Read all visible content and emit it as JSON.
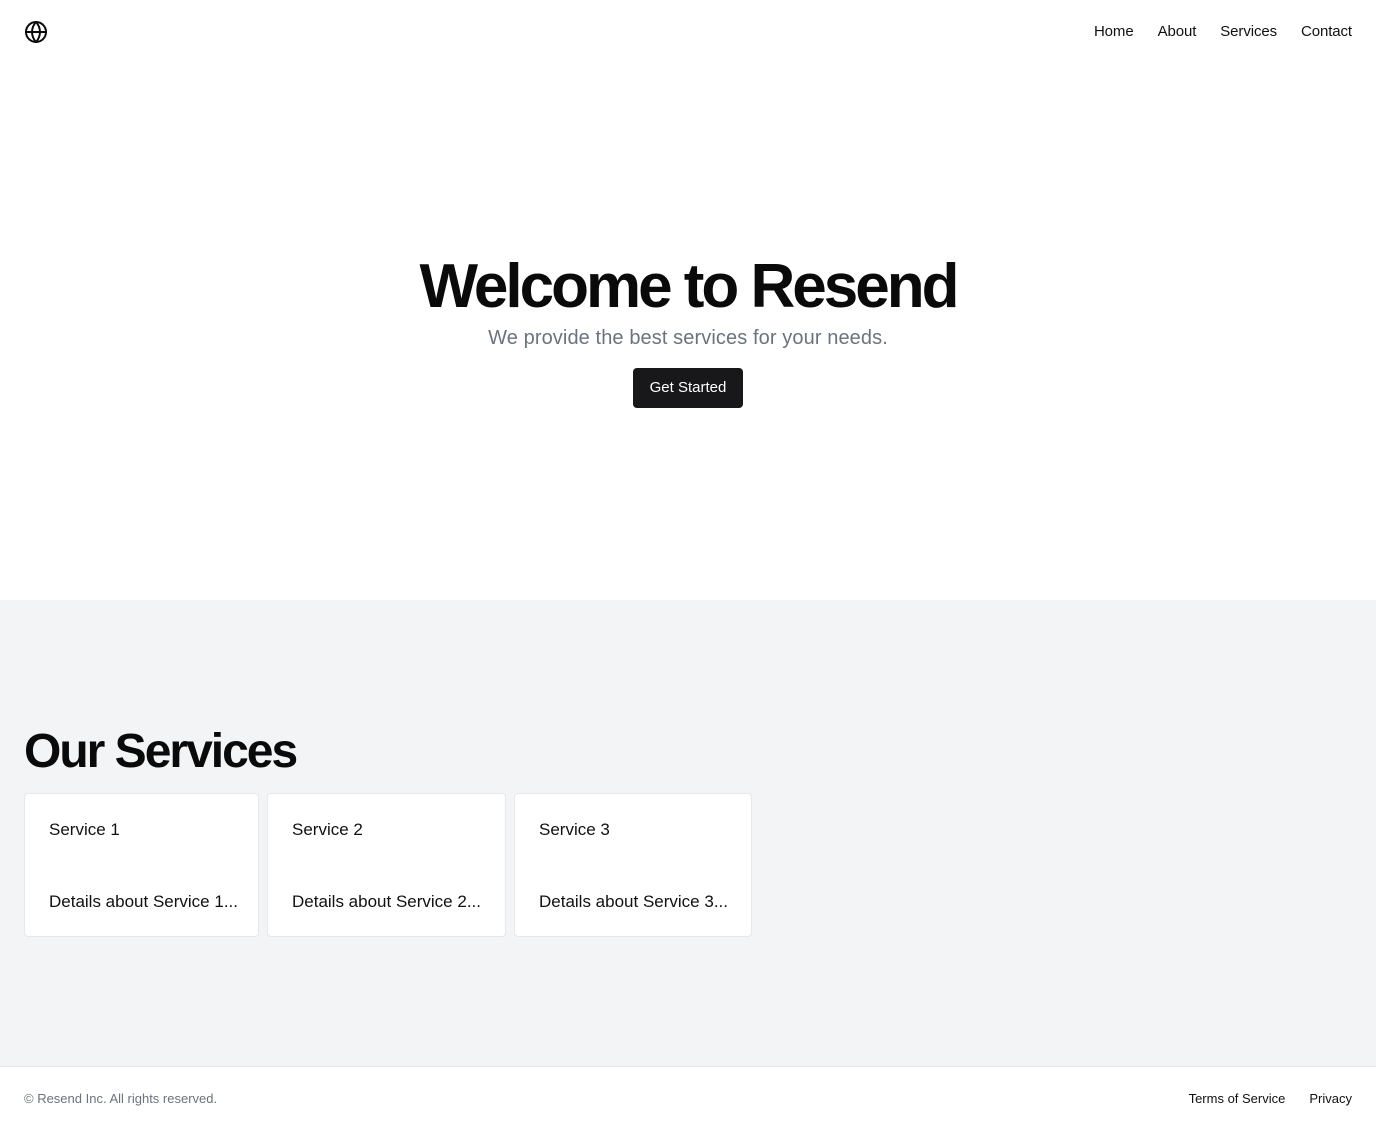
{
  "header": {
    "logo_icon": "globe-icon",
    "nav": [
      {
        "label": "Home"
      },
      {
        "label": "About"
      },
      {
        "label": "Services"
      },
      {
        "label": "Contact"
      }
    ]
  },
  "hero": {
    "title": "Welcome to Resend",
    "subtitle": "We provide the best services for your needs.",
    "cta_label": "Get Started"
  },
  "services": {
    "title": "Our Services",
    "cards": [
      {
        "title": "Service 1",
        "description": "Details about Service 1..."
      },
      {
        "title": "Service 2",
        "description": "Details about Service 2..."
      },
      {
        "title": "Service 3",
        "description": "Details about Service 3..."
      }
    ]
  },
  "footer": {
    "copyright": "© Resend Inc. All rights reserved.",
    "links": [
      {
        "label": "Terms of Service"
      },
      {
        "label": "Privacy"
      }
    ]
  },
  "colors": {
    "button_bg": "#18181b",
    "section_bg": "#f2f4f6",
    "muted_text": "#6b7280"
  }
}
